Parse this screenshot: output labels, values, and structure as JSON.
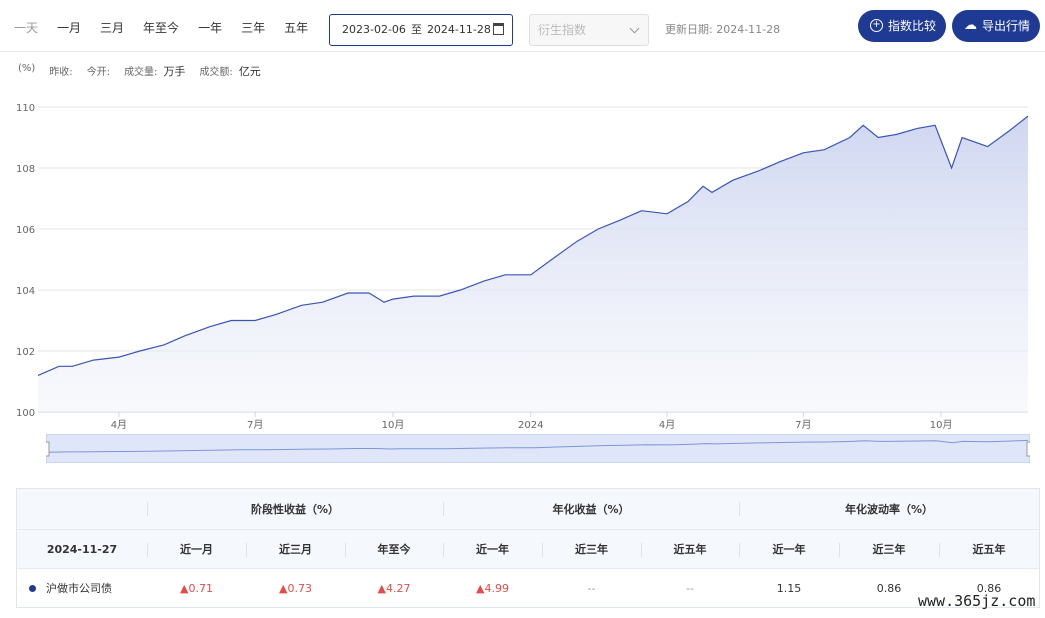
{
  "toolbar": {
    "range_tabs": [
      "一天",
      "一月",
      "三月",
      "年至今",
      "一年",
      "三年",
      "五年"
    ],
    "date_start": "2023-02-06",
    "date_separator": "至",
    "date_end": "2024-11-28",
    "calendar_icon": "calendar-icon",
    "derived_index_placeholder": "衍生指数",
    "update_label": "更新日期:",
    "update_date": "2024-11-28",
    "compare_button": "指数比较",
    "compare_icon": "plus-circle-icon",
    "export_button": "导出行情",
    "export_icon": "cloud-upload-icon"
  },
  "info": {
    "unit": "(%)",
    "prev_close_label": "昨收:",
    "open_label": "今开:",
    "volume_label": "成交量:",
    "volume_unit": "万手",
    "amount_label": "成交额:",
    "amount_unit": "亿元"
  },
  "colors": {
    "accent": "#1f3a93",
    "line": "#3a55b8",
    "area_top": "#c9d1ee",
    "up": "#e84a4a"
  },
  "chart_data": {
    "type": "area",
    "title": "",
    "xlabel": "",
    "ylabel": "(%)",
    "ylim": [
      100,
      110
    ],
    "yticks": [
      100,
      102,
      104,
      106,
      108,
      110
    ],
    "x_tick_labels": [
      "4月",
      "7月",
      "10月",
      "2024",
      "4月",
      "7月",
      "10月"
    ],
    "x_tick_dates": [
      "2023-04-01",
      "2023-07-01",
      "2023-10-01",
      "2024-01-01",
      "2024-04-01",
      "2024-07-01",
      "2024-10-01"
    ],
    "x_start": "2023-02-06",
    "x_end": "2024-11-28",
    "grid": true,
    "series": [
      {
        "x": [
          "2023-02-06",
          "2023-02-20",
          "2023-03-01",
          "2023-03-15",
          "2023-04-01",
          "2023-04-15",
          "2023-05-01",
          "2023-05-15",
          "2023-06-01",
          "2023-06-15",
          "2023-07-01",
          "2023-07-15",
          "2023-08-01",
          "2023-08-15",
          "2023-09-01",
          "2023-09-15",
          "2023-09-25",
          "2023-10-01",
          "2023-10-15",
          "2023-11-01",
          "2023-11-15",
          "2023-12-01",
          "2023-12-15",
          "2024-01-01",
          "2024-01-15",
          "2024-02-01",
          "2024-02-15",
          "2024-03-01",
          "2024-03-15",
          "2024-04-01",
          "2024-04-15",
          "2024-04-25",
          "2024-05-01",
          "2024-05-15",
          "2024-06-01",
          "2024-06-15",
          "2024-07-01",
          "2024-07-15",
          "2024-08-01",
          "2024-08-10",
          "2024-08-20",
          "2024-09-01",
          "2024-09-15",
          "2024-09-27",
          "2024-10-08",
          "2024-10-15",
          "2024-11-01",
          "2024-11-15",
          "2024-11-28"
        ],
        "values": [
          101.2,
          101.5,
          101.5,
          101.7,
          101.8,
          102.0,
          102.2,
          102.5,
          102.8,
          103.0,
          103.0,
          103.2,
          103.5,
          103.6,
          103.9,
          103.9,
          103.6,
          103.7,
          103.8,
          103.8,
          104.0,
          104.3,
          104.5,
          104.5,
          105.0,
          105.6,
          106.0,
          106.3,
          106.6,
          106.5,
          106.9,
          107.4,
          107.2,
          107.6,
          107.9,
          108.2,
          108.5,
          108.6,
          109.0,
          109.4,
          109.0,
          109.1,
          109.3,
          109.4,
          108.0,
          109.0,
          108.7,
          109.2,
          109.7
        ]
      }
    ]
  },
  "table": {
    "group_headers": [
      "阶段性收益（%）",
      "年化收益（%）",
      "年化波动率（%）"
    ],
    "date": "2024-11-27",
    "sub_headers": [
      "近一月",
      "近三月",
      "年至今",
      "近一年",
      "近三年",
      "近五年",
      "近一年",
      "近三年",
      "近五年"
    ],
    "row": {
      "name": "沪做市公司债",
      "values": [
        "▲0.71",
        "▲0.73",
        "▲4.27",
        "▲4.99",
        "--",
        "--",
        "1.15",
        "0.86",
        "0.86"
      ]
    }
  },
  "watermark": "www.365jz.com"
}
